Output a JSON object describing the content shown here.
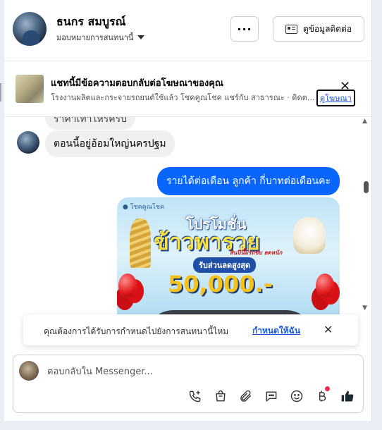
{
  "header": {
    "contact_name": "ธนกร สมบูรณ์",
    "assign_label": "มอบหมายการสนทนานี้",
    "more_label": "···",
    "contact_info_label": "ดูข้อมูลติดต่อ"
  },
  "ad_banner": {
    "title": "แชทนี้มีข้อความตอบกลับต่อโฆษณาของคุณ",
    "description": "โรงงานผลิตและกระจายรถยนต์ใช้แล้ว โชคคูณโชค แชร์กับ สาธารณะ · ดิดต…",
    "view_ad_label": "ดูโฆษณา",
    "close_label": "✕"
  },
  "messages": {
    "partial_incoming": "ราคาเท่าไหร่ครับ",
    "incoming": "ตอนนี้อยู่อ้อมใหญ่นครปฐม",
    "outgoing": "รายได้ต่อเดือน ลูกค้า   กี่บาทต่อเดือนคะ"
  },
  "promo_image": {
    "logo_text": "● โชคคูณโชค",
    "line1": "โปรโมชั่น",
    "line2": "ข้าวพารวย",
    "subtitle": "สินปีนี้มีรถขับ ลดหนัก",
    "discount_label": "รับส่วนลดสูงสุด",
    "amount": "50,000.-"
  },
  "notification": {
    "text": "คุณต้องการได้รับการกำหนดไปยังการสนทนานี้ไหม",
    "link_label": "กำหนดให้ฉัน",
    "close_label": "✕"
  },
  "composer": {
    "placeholder": "ตอบกลับใน Messenger..."
  },
  "colors": {
    "accent": "#0866ff",
    "link": "#1b59d6",
    "notification_dot": "#f02849"
  }
}
